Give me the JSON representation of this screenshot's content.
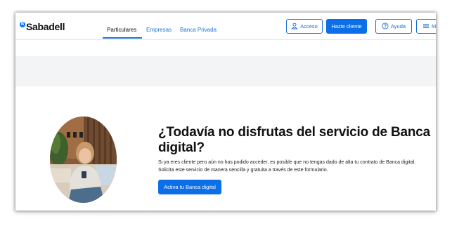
{
  "header": {
    "logo_mark": "B",
    "logo": "Sabadell",
    "nav": [
      "Particulares",
      "Empresas",
      "Banca Privada"
    ],
    "acceso": "Acceso",
    "hazte_cliente": "Hazte cliente",
    "ayuda": "Ayuda",
    "menu": "M"
  },
  "main": {
    "headline": "¿Todavía no disfrutas del servicio de Banca digital?",
    "desc_line1": "Si ya eres cliente pero aún no has podido acceder, es posible que no tengas dado de alta tu contrato de Banca digital.",
    "desc_line2": "Solicita este servicio de manera sencilla y gratuita a través de este formulario.",
    "cta": "Activa tu Banca digital"
  },
  "colors": {
    "brand_blue": "#0a6fe8",
    "link_blue": "#1a73d9",
    "band_gray": "#f3f4f6"
  },
  "icons": [
    "user-icon",
    "help-circle-icon",
    "hamburger-menu-icon"
  ]
}
